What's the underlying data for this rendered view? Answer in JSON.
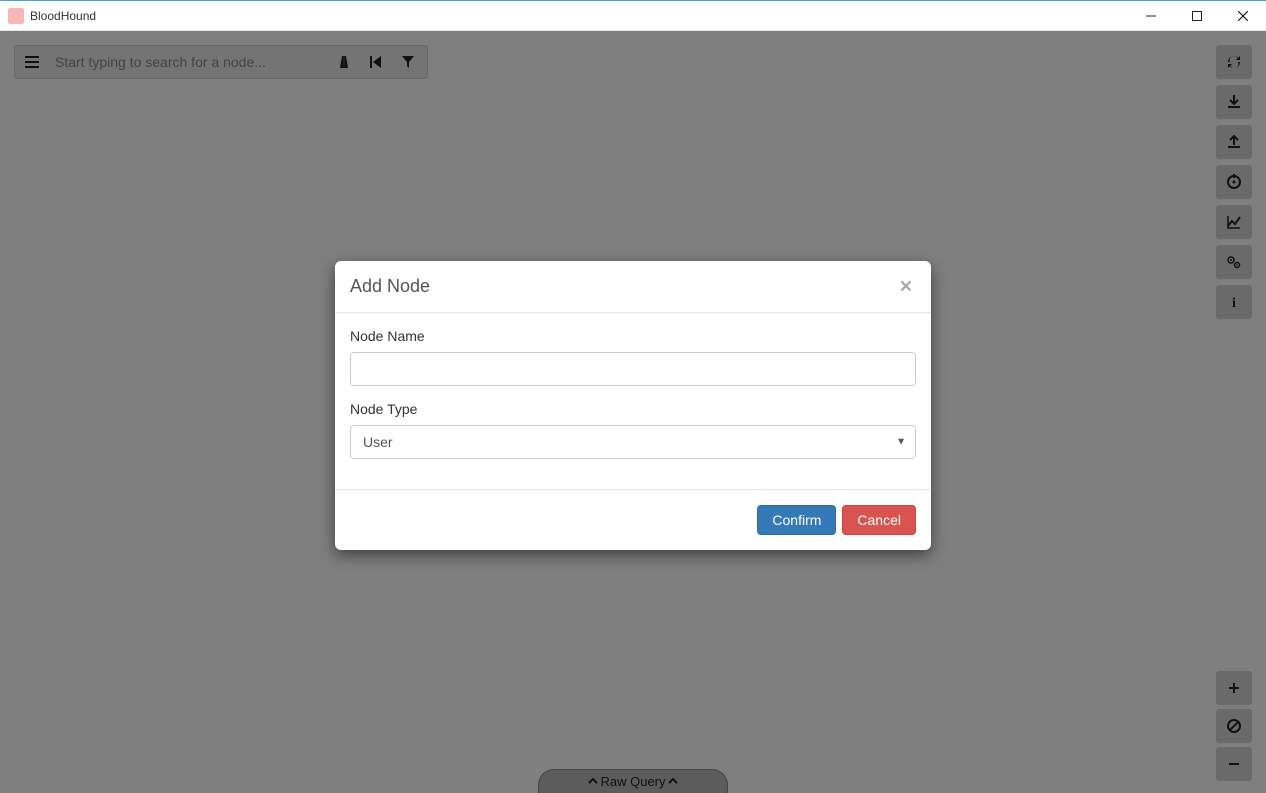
{
  "window": {
    "title": "BloodHound"
  },
  "search": {
    "placeholder": "Start typing to search for a node...",
    "value": ""
  },
  "right_actions": [
    {
      "name": "refresh",
      "icon": "refresh-icon"
    },
    {
      "name": "download",
      "icon": "download-icon"
    },
    {
      "name": "upload",
      "icon": "upload-icon"
    },
    {
      "name": "target",
      "icon": "target-icon"
    },
    {
      "name": "chart",
      "icon": "chart-icon"
    },
    {
      "name": "settings",
      "icon": "settings-icon"
    },
    {
      "name": "info",
      "icon": "info-icon"
    }
  ],
  "zoom": {
    "in": "+",
    "reset": "⦸",
    "out": "−"
  },
  "bottom_tab": {
    "label": "Raw Query"
  },
  "modal": {
    "title": "Add Node",
    "fields": {
      "node_name_label": "Node Name",
      "node_name_value": "",
      "node_type_label": "Node Type",
      "node_type_value": "User"
    },
    "buttons": {
      "confirm": "Confirm",
      "cancel": "Cancel"
    }
  }
}
